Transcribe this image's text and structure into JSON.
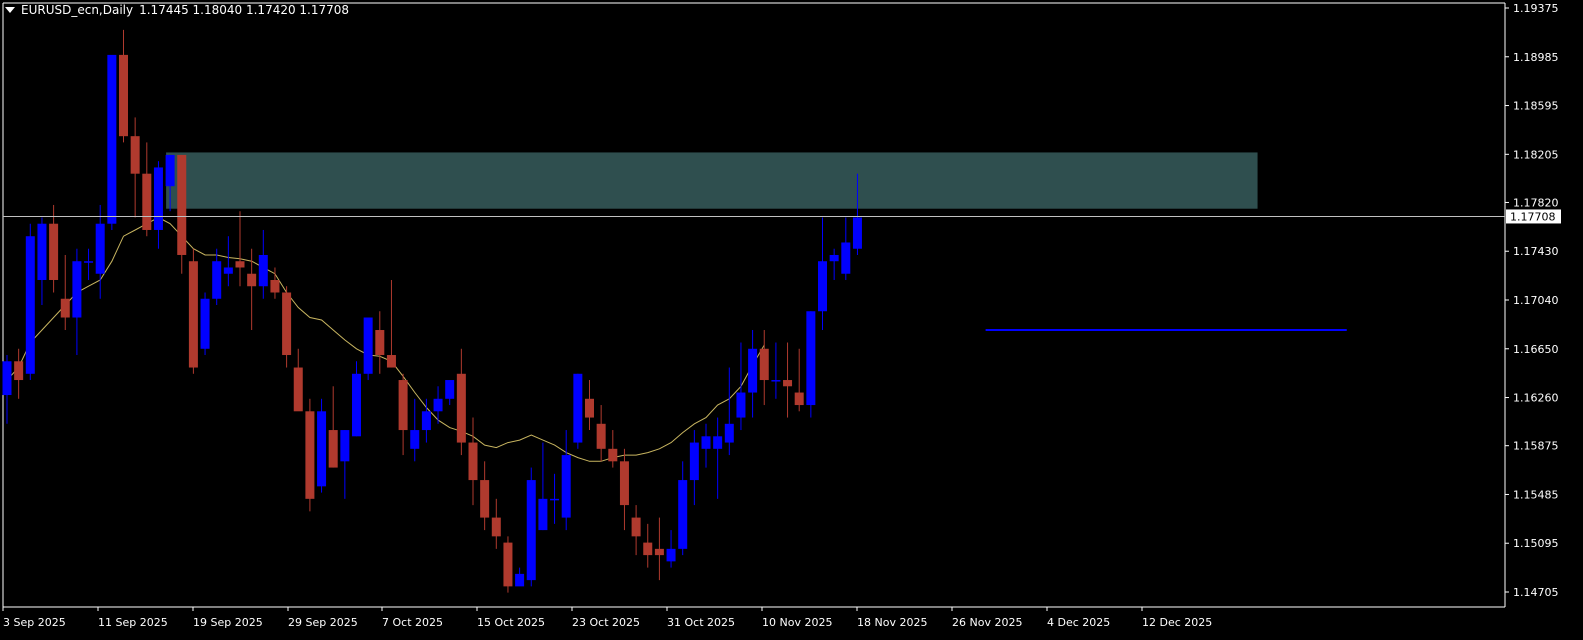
{
  "title": {
    "symbol": "EURUSD_ecn,Daily",
    "ohlc": "1.17445 1.18040 1.17420 1.17708"
  },
  "colors": {
    "background": "#000000",
    "axis": "#ffffff",
    "bull_candle": "#0000ff",
    "bear_candle": "#b03a2e",
    "moving_average": "#c8b560",
    "zone": "#2f4f4f",
    "support_line": "#0000ff",
    "price_line": "#c0c0c0"
  },
  "chart_data": {
    "type": "candlestick",
    "grid": false,
    "y_ticks": [
      "1.19375",
      "1.18985",
      "1.18595",
      "1.18205",
      "1.17820",
      "1.17430",
      "1.17040",
      "1.16650",
      "1.16260",
      "1.15875",
      "1.15485",
      "1.15095",
      "1.14705"
    ],
    "x_ticks": [
      "3 Sep 2025",
      "11 Sep 2025",
      "19 Sep 2025",
      "29 Sep 2025",
      "7 Oct 2025",
      "15 Oct 2025",
      "23 Oct 2025",
      "31 Oct 2025",
      "10 Nov 2025",
      "18 Nov 2025",
      "26 Nov 2025",
      "4 Dec 2025",
      "12 Dec 2025"
    ],
    "ylim": [
      1.1465,
      1.1945
    ],
    "current_price_label": "1.17708",
    "current_price": 1.17708,
    "zone": {
      "from_bar": 14,
      "to_bar": 107,
      "low": 1.1777,
      "high": 1.1822
    },
    "support_line": {
      "from_bar": 84,
      "to_bar": 115,
      "value": 1.168
    },
    "candles": [
      [
        1.1628,
        1.166,
        1.1605,
        1.1655
      ],
      [
        1.1655,
        1.1665,
        1.1625,
        1.164
      ],
      [
        1.1645,
        1.1765,
        1.164,
        1.1755
      ],
      [
        1.172,
        1.177,
        1.17,
        1.1765
      ],
      [
        1.1765,
        1.178,
        1.171,
        1.172
      ],
      [
        1.1705,
        1.174,
        1.168,
        1.169
      ],
      [
        1.169,
        1.1745,
        1.166,
        1.1735
      ],
      [
        1.1735,
        1.1745,
        1.172,
        1.1735
      ],
      [
        1.1725,
        1.178,
        1.1705,
        1.1765
      ],
      [
        1.1765,
        1.187,
        1.176,
        1.19
      ],
      [
        1.19,
        1.192,
        1.183,
        1.1835
      ],
      [
        1.1835,
        1.185,
        1.177,
        1.1805
      ],
      [
        1.1805,
        1.183,
        1.1755,
        1.176
      ],
      [
        1.176,
        1.1815,
        1.1745,
        1.181
      ],
      [
        1.1795,
        1.182,
        1.1775,
        1.182
      ],
      [
        1.182,
        1.182,
        1.1725,
        1.174
      ],
      [
        1.1735,
        1.1745,
        1.1645,
        1.165
      ],
      [
        1.1665,
        1.171,
        1.166,
        1.1705
      ],
      [
        1.1705,
        1.1745,
        1.17,
        1.1735
      ],
      [
        1.1725,
        1.1755,
        1.1715,
        1.173
      ],
      [
        1.1735,
        1.1775,
        1.1715,
        1.173
      ],
      [
        1.1725,
        1.1745,
        1.168,
        1.1715
      ],
      [
        1.1715,
        1.176,
        1.1705,
        1.174
      ],
      [
        1.172,
        1.173,
        1.1705,
        1.171
      ],
      [
        1.171,
        1.1715,
        1.165,
        1.166
      ],
      [
        1.165,
        1.1665,
        1.164,
        1.1615
      ],
      [
        1.1615,
        1.1625,
        1.1535,
        1.1545
      ],
      [
        1.1555,
        1.1625,
        1.155,
        1.1615
      ],
      [
        1.16,
        1.1635,
        1.157,
        1.157
      ],
      [
        1.1575,
        1.16,
        1.1545,
        1.16
      ],
      [
        1.1595,
        1.1655,
        1.1595,
        1.1645
      ],
      [
        1.1645,
        1.169,
        1.164,
        1.169
      ],
      [
        1.168,
        1.1695,
        1.1645,
        1.166
      ],
      [
        1.166,
        1.172,
        1.165,
        1.165
      ],
      [
        1.164,
        1.1645,
        1.158,
        1.16
      ],
      [
        1.1585,
        1.1625,
        1.1575,
        1.16
      ],
      [
        1.16,
        1.1625,
        1.159,
        1.1615
      ],
      [
        1.1615,
        1.1635,
        1.1605,
        1.1625
      ],
      [
        1.1625,
        1.1635,
        1.162,
        1.164
      ],
      [
        1.1645,
        1.1665,
        1.158,
        1.159
      ],
      [
        1.159,
        1.161,
        1.154,
        1.156
      ],
      [
        1.156,
        1.1575,
        1.152,
        1.153
      ],
      [
        1.153,
        1.1545,
        1.1505,
        1.1515
      ],
      [
        1.151,
        1.1515,
        1.147,
        1.1475
      ],
      [
        1.1475,
        1.149,
        1.148,
        1.1485
      ],
      [
        1.148,
        1.157,
        1.1475,
        1.156
      ],
      [
        1.152,
        1.159,
        1.152,
        1.1545
      ],
      [
        1.1545,
        1.1565,
        1.1525,
        1.1545
      ],
      [
        1.153,
        1.16,
        1.152,
        1.158
      ],
      [
        1.159,
        1.1645,
        1.1585,
        1.1645
      ],
      [
        1.1625,
        1.164,
        1.16,
        1.161
      ],
      [
        1.1605,
        1.162,
        1.1575,
        1.1585
      ],
      [
        1.1585,
        1.16,
        1.157,
        1.1575
      ],
      [
        1.1575,
        1.1585,
        1.152,
        1.154
      ],
      [
        1.153,
        1.154,
        1.15,
        1.1515
      ],
      [
        1.151,
        1.1525,
        1.149,
        1.15
      ],
      [
        1.1505,
        1.153,
        1.148,
        1.15
      ],
      [
        1.1495,
        1.152,
        1.149,
        1.1505
      ],
      [
        1.1505,
        1.1575,
        1.15,
        1.156
      ],
      [
        1.156,
        1.16,
        1.154,
        1.159
      ],
      [
        1.1585,
        1.1605,
        1.157,
        1.1595
      ],
      [
        1.1585,
        1.161,
        1.1545,
        1.1595
      ],
      [
        1.159,
        1.165,
        1.158,
        1.1605
      ],
      [
        1.161,
        1.167,
        1.16,
        1.163
      ],
      [
        1.163,
        1.168,
        1.161,
        1.1665
      ],
      [
        1.1665,
        1.168,
        1.162,
        1.164
      ],
      [
        1.164,
        1.167,
        1.1625,
        1.164
      ],
      [
        1.164,
        1.167,
        1.161,
        1.1635
      ],
      [
        1.163,
        1.1665,
        1.1615,
        1.162
      ],
      [
        1.162,
        1.1695,
        1.161,
        1.1695
      ],
      [
        1.1695,
        1.177,
        1.168,
        1.1735
      ],
      [
        1.1735,
        1.1745,
        1.172,
        1.174
      ],
      [
        1.1725,
        1.177,
        1.172,
        1.175
      ],
      [
        1.1745,
        1.1805,
        1.174,
        1.177
      ]
    ],
    "ma": [
      1.164,
      1.165,
      1.167,
      1.168,
      1.169,
      1.17,
      1.171,
      1.1715,
      1.172,
      1.1735,
      1.1755,
      1.176,
      1.1765,
      1.177,
      1.1765,
      1.1755,
      1.1745,
      1.174,
      1.174,
      1.1738,
      1.1737,
      1.1735,
      1.173,
      1.1725,
      1.171,
      1.1698,
      1.169,
      1.1688,
      1.168,
      1.1672,
      1.1665,
      1.166,
      1.1659,
      1.1655,
      1.1643,
      1.163,
      1.1618,
      1.1608,
      1.1602,
      1.1599,
      1.1595,
      1.1588,
      1.1586,
      1.159,
      1.1592,
      1.1596,
      1.1592,
      1.1588,
      1.1582,
      1.1578,
      1.1575,
      1.1575,
      1.1578,
      1.158,
      1.158,
      1.1582,
      1.1585,
      1.159,
      1.1598,
      1.1605,
      1.161,
      1.162,
      1.1625,
      1.1635,
      1.1652,
      1.1668
    ]
  }
}
